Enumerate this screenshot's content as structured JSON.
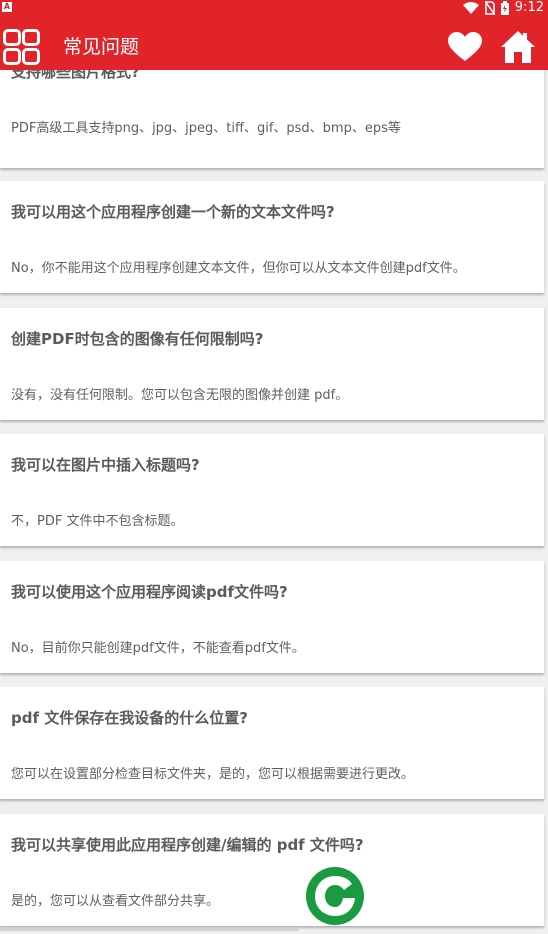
{
  "status_bar": {
    "notification_glyph": "A",
    "time": "9:12",
    "icons": [
      "wifi-icon",
      "no-sim-icon",
      "battery-icon"
    ]
  },
  "app_bar": {
    "title": "常见问题",
    "left_icon": "grid-menu-icon",
    "right_icons": [
      "heart-icon",
      "home-icon"
    ]
  },
  "faq": [
    {
      "question": "支持哪些图片格式?",
      "answer": "PDF高级工具支持png、jpg、jpeg、tiff、gif、psd、bmp、eps等"
    },
    {
      "question": "我可以用这个应用程序创建一个新的文本文件吗?",
      "answer": "No，你不能用这个应用程序创建文本文件，但你可以从文本文件创建pdf文件。"
    },
    {
      "question": "创建PDF时包含的图像有任何限制吗?",
      "answer": "没有，没有任何限制。您可以包含无限的图像并创建 pdf。"
    },
    {
      "question": "我可以在图片中插入标题吗?",
      "answer": "不，PDF 文件中不包含标题。"
    },
    {
      "question": "我可以使用这个应用程序阅读pdf文件吗?",
      "answer": "No，目前你只能创建pdf文件，不能查看pdf文件。"
    },
    {
      "question": "pdf 文件保存在我设备的什么位置?",
      "answer": "您可以在设置部分检查目标文件夹，是的，您可以根据需要进行更改。"
    },
    {
      "question": "我可以共享使用此应用程序创建/编辑的 pdf 文件吗?",
      "answer": "是的，您可以从查看文件部分共享。"
    }
  ],
  "colors": {
    "primary": "#e0242a",
    "logo_green": "#1a9b3f"
  }
}
